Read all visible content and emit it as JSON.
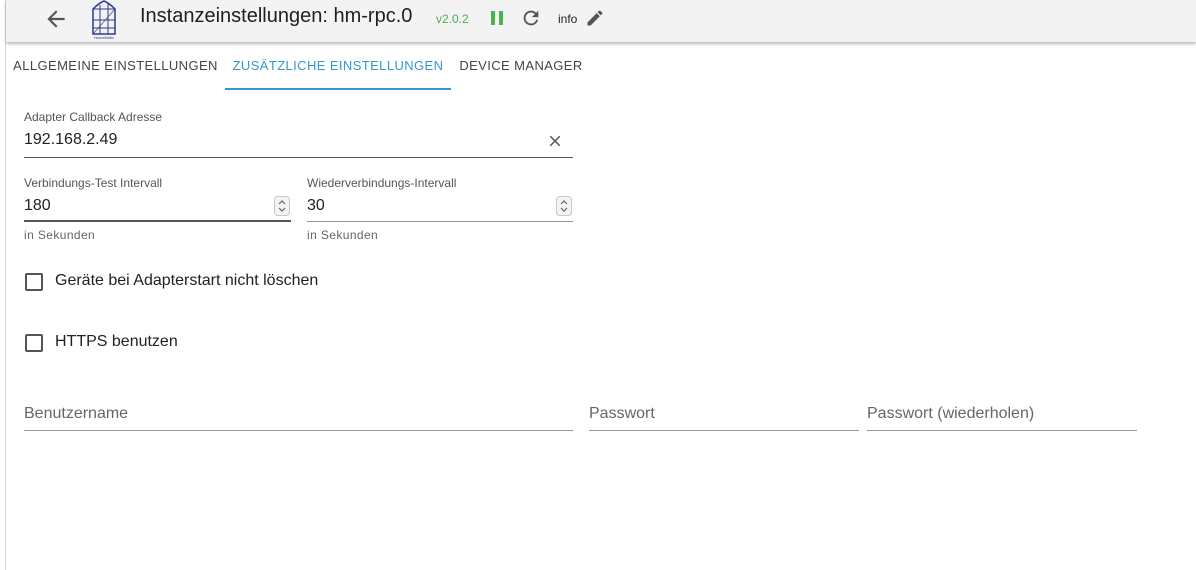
{
  "header": {
    "title": "Instanzeinstellungen: hm-rpc.0",
    "version": "v2.0.2",
    "info_label": "info",
    "logo_text": "HomeMatic"
  },
  "tabs": [
    {
      "label": "ALLGEMEINE EINSTELLUNGEN",
      "active": false
    },
    {
      "label": "ZUSÄTZLICHE EINSTELLUNGEN",
      "active": true
    },
    {
      "label": "DEVICE MANAGER",
      "active": false
    }
  ],
  "form": {
    "callback": {
      "label": "Adapter Callback Adresse",
      "value": "192.168.2.49"
    },
    "check_interval": {
      "label": "Verbindungs-Test Intervall",
      "value": "180",
      "helper": "in Sekunden"
    },
    "reconnect_interval": {
      "label": "Wiederverbindungs-Intervall",
      "value": "30",
      "helper": "in Sekunden"
    },
    "dont_delete": {
      "label": "Geräte bei Adapterstart nicht löschen",
      "checked": false
    },
    "https": {
      "label": "HTTPS benutzen",
      "checked": false
    },
    "username": {
      "placeholder": "Benutzername"
    },
    "password": {
      "placeholder": "Passwort"
    },
    "password_repeat": {
      "placeholder": "Passwort (wiederholen)"
    }
  },
  "colors": {
    "accent": "#3399cc",
    "version_green": "#4caf50",
    "logo_blue": "#2a3d8f"
  }
}
